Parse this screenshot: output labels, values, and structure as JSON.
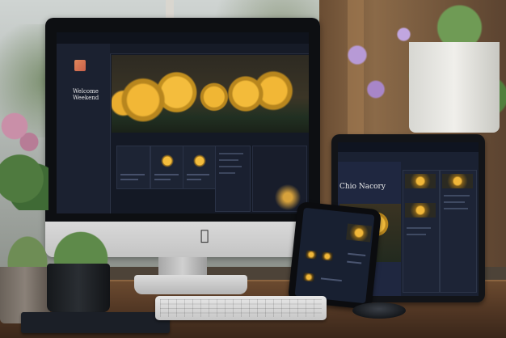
{
  "scene": {
    "description_label": "Responsive devices mockup on a desk",
    "colors": {
      "accent_flower": "#f2b736",
      "screen_bg": "#141925",
      "sidebar_bg": "#1b2130"
    },
    "icons": [
      "apple-logo-icon"
    ]
  },
  "imac": {
    "sidebar_title": "Welcome\nWeekend",
    "sidebar_links": [
      "",
      "",
      "",
      "",
      "",
      "",
      "",
      "",
      "",
      ""
    ],
    "top_items": [
      "",
      "",
      "",
      "",
      ""
    ],
    "nav_items": [
      "",
      "",
      "",
      "",
      "",
      ""
    ],
    "section_label": "",
    "section_label_2": ""
  },
  "tablet": {
    "title": "Chio Nacory"
  },
  "phone": {
    "title": ""
  }
}
